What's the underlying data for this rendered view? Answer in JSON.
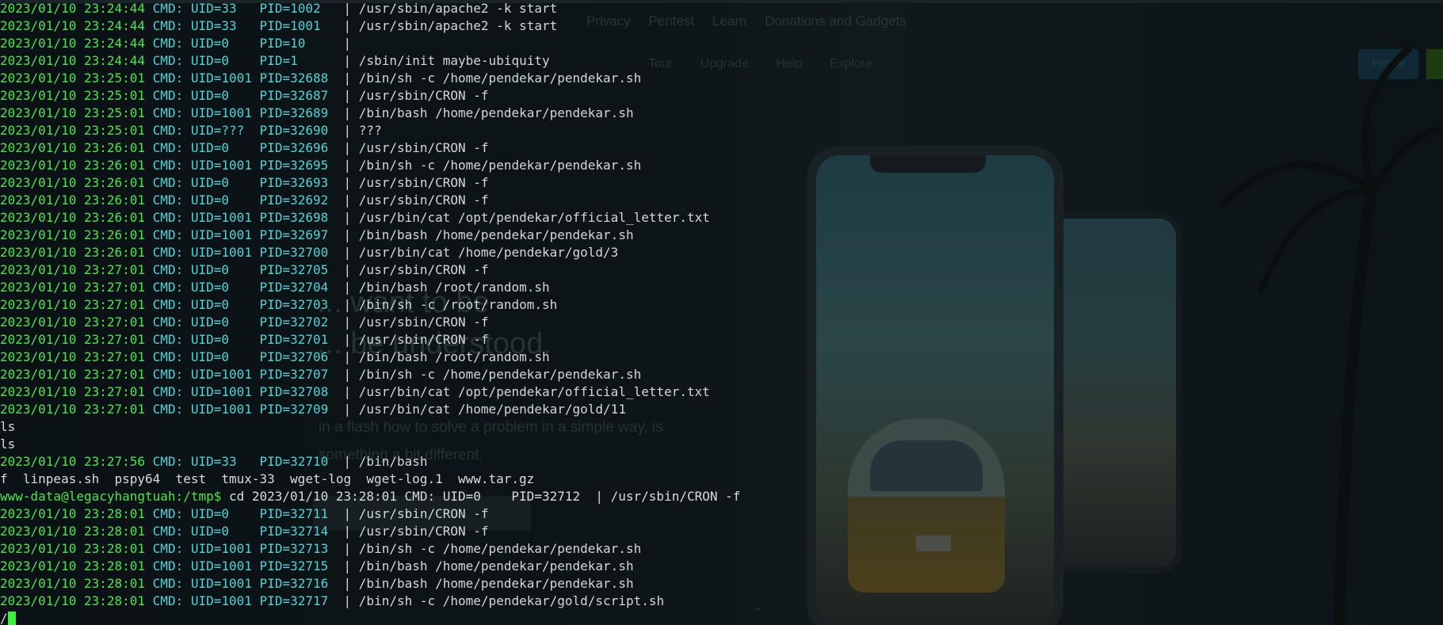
{
  "background_site": {
    "nav_primary": [
      "Privacy",
      "Pentest",
      "Learn",
      "Donations and Gadgets"
    ],
    "nav_secondary": [
      "Tour",
      "Upgrade",
      "Help",
      "Explore"
    ],
    "profile_button": "Profile",
    "headline_lines": [
      "... want to be",
      "... be understood."
    ],
    "paragraph_lines": [
      "in a flash how to solve a problem in a simple way, is",
      "something a bit different."
    ]
  },
  "terminal": {
    "cursor_prefix": "/",
    "lines": [
      {
        "kind": "pspy",
        "ts": "2023/01/10 23:24:44",
        "cmd": "CMD:",
        "uid": "UID=33  ",
        "pid": "PID=1002 ",
        "sep": "|",
        "command": "/usr/sbin/apache2 -k start"
      },
      {
        "kind": "pspy",
        "ts": "2023/01/10 23:24:44",
        "cmd": "CMD:",
        "uid": "UID=33  ",
        "pid": "PID=1001 ",
        "sep": "|",
        "command": "/usr/sbin/apache2 -k start"
      },
      {
        "kind": "pspy",
        "ts": "2023/01/10 23:24:44",
        "cmd": "CMD:",
        "uid": "UID=0   ",
        "pid": "PID=10   ",
        "sep": "|",
        "command": ""
      },
      {
        "kind": "pspy",
        "ts": "2023/01/10 23:24:44",
        "cmd": "CMD:",
        "uid": "UID=0   ",
        "pid": "PID=1    ",
        "sep": "|",
        "command": "/sbin/init maybe-ubiquity"
      },
      {
        "kind": "pspy",
        "ts": "2023/01/10 23:25:01",
        "cmd": "CMD:",
        "uid": "UID=1001",
        "pid": "PID=32688",
        "sep": "|",
        "command": "/bin/sh -c /home/pendekar/pendekar.sh"
      },
      {
        "kind": "pspy",
        "ts": "2023/01/10 23:25:01",
        "cmd": "CMD:",
        "uid": "UID=0   ",
        "pid": "PID=32687",
        "sep": "|",
        "command": "/usr/sbin/CRON -f"
      },
      {
        "kind": "pspy",
        "ts": "2023/01/10 23:25:01",
        "cmd": "CMD:",
        "uid": "UID=1001",
        "pid": "PID=32689",
        "sep": "|",
        "command": "/bin/bash /home/pendekar/pendekar.sh"
      },
      {
        "kind": "pspy",
        "ts": "2023/01/10 23:25:01",
        "cmd": "CMD:",
        "uid": "UID=???",
        "pid": " PID=32690",
        "sep": "|",
        "command": "???"
      },
      {
        "kind": "pspy",
        "ts": "2023/01/10 23:26:01",
        "cmd": "CMD:",
        "uid": "UID=0   ",
        "pid": "PID=32696",
        "sep": "|",
        "command": "/usr/sbin/CRON -f"
      },
      {
        "kind": "pspy",
        "ts": "2023/01/10 23:26:01",
        "cmd": "CMD:",
        "uid": "UID=1001",
        "pid": "PID=32695",
        "sep": "|",
        "command": "/bin/sh -c /home/pendekar/pendekar.sh"
      },
      {
        "kind": "pspy",
        "ts": "2023/01/10 23:26:01",
        "cmd": "CMD:",
        "uid": "UID=0   ",
        "pid": "PID=32693",
        "sep": "|",
        "command": "/usr/sbin/CRON -f"
      },
      {
        "kind": "pspy",
        "ts": "2023/01/10 23:26:01",
        "cmd": "CMD:",
        "uid": "UID=0   ",
        "pid": "PID=32692",
        "sep": "|",
        "command": "/usr/sbin/CRON -f"
      },
      {
        "kind": "pspy",
        "ts": "2023/01/10 23:26:01",
        "cmd": "CMD:",
        "uid": "UID=1001",
        "pid": "PID=32698",
        "sep": "|",
        "command": "/usr/bin/cat /opt/pendekar/official_letter.txt"
      },
      {
        "kind": "pspy",
        "ts": "2023/01/10 23:26:01",
        "cmd": "CMD:",
        "uid": "UID=1001",
        "pid": "PID=32697",
        "sep": "|",
        "command": "/bin/bash /home/pendekar/pendekar.sh"
      },
      {
        "kind": "pspy",
        "ts": "2023/01/10 23:26:01",
        "cmd": "CMD:",
        "uid": "UID=1001",
        "pid": "PID=32700",
        "sep": "|",
        "command": "/usr/bin/cat /home/pendekar/gold/3"
      },
      {
        "kind": "pspy",
        "ts": "2023/01/10 23:27:01",
        "cmd": "CMD:",
        "uid": "UID=0   ",
        "pid": "PID=32705",
        "sep": "|",
        "command": "/usr/sbin/CRON -f"
      },
      {
        "kind": "pspy",
        "ts": "2023/01/10 23:27:01",
        "cmd": "CMD:",
        "uid": "UID=0   ",
        "pid": "PID=32704",
        "sep": "|",
        "command": "/bin/bash /root/random.sh"
      },
      {
        "kind": "pspy",
        "ts": "2023/01/10 23:27:01",
        "cmd": "CMD:",
        "uid": "UID=0   ",
        "pid": "PID=32703",
        "sep": "|",
        "command": "/bin/sh -c /root/random.sh"
      },
      {
        "kind": "pspy",
        "ts": "2023/01/10 23:27:01",
        "cmd": "CMD:",
        "uid": "UID=0   ",
        "pid": "PID=32702",
        "sep": "|",
        "command": "/usr/sbin/CRON -f"
      },
      {
        "kind": "pspy",
        "ts": "2023/01/10 23:27:01",
        "cmd": "CMD:",
        "uid": "UID=0   ",
        "pid": "PID=32701",
        "sep": "|",
        "command": "/usr/sbin/CRON -f"
      },
      {
        "kind": "pspy",
        "ts": "2023/01/10 23:27:01",
        "cmd": "CMD:",
        "uid": "UID=0   ",
        "pid": "PID=32706",
        "sep": "|",
        "command": "/bin/bash /root/random.sh"
      },
      {
        "kind": "pspy",
        "ts": "2023/01/10 23:27:01",
        "cmd": "CMD:",
        "uid": "UID=1001",
        "pid": "PID=32707",
        "sep": "|",
        "command": "/bin/sh -c /home/pendekar/pendekar.sh"
      },
      {
        "kind": "pspy",
        "ts": "2023/01/10 23:27:01",
        "cmd": "CMD:",
        "uid": "UID=1001",
        "pid": "PID=32708",
        "sep": "|",
        "command": "/usr/bin/cat /opt/pendekar/official_letter.txt"
      },
      {
        "kind": "pspy",
        "ts": "2023/01/10 23:27:01",
        "cmd": "CMD:",
        "uid": "UID=1001",
        "pid": "PID=32709",
        "sep": "|",
        "command": "/usr/bin/cat /home/pendekar/gold/11"
      },
      {
        "kind": "plain",
        "text": "ls"
      },
      {
        "kind": "plain",
        "text": "ls"
      },
      {
        "kind": "pspy",
        "ts": "2023/01/10 23:27:56",
        "cmd": "CMD:",
        "uid": "UID=33  ",
        "pid": "PID=32710",
        "sep": "|",
        "command": "/bin/bash"
      },
      {
        "kind": "plain",
        "text": "f  linpeas.sh  pspy64  test  tmux-33  wget-log  wget-log.1  www.tar.gz"
      },
      {
        "kind": "prompt",
        "prompt": "www-data@legacyhangtuah:/tmp$",
        "text": " cd 2023/01/10 23:28:01 CMD: UID=0    PID=32712  | /usr/sbin/CRON -f"
      },
      {
        "kind": "pspy",
        "ts": "2023/01/10 23:28:01",
        "cmd": "CMD:",
        "uid": "UID=0   ",
        "pid": "PID=32711",
        "sep": "|",
        "command": "/usr/sbin/CRON -f"
      },
      {
        "kind": "pspy",
        "ts": "2023/01/10 23:28:01",
        "cmd": "CMD:",
        "uid": "UID=0   ",
        "pid": "PID=32714",
        "sep": "|",
        "command": "/usr/sbin/CRON -f"
      },
      {
        "kind": "pspy",
        "ts": "2023/01/10 23:28:01",
        "cmd": "CMD:",
        "uid": "UID=1001",
        "pid": "PID=32713",
        "sep": "|",
        "command": "/bin/sh -c /home/pendekar/pendekar.sh"
      },
      {
        "kind": "pspy",
        "ts": "2023/01/10 23:28:01",
        "cmd": "CMD:",
        "uid": "UID=1001",
        "pid": "PID=32715",
        "sep": "|",
        "command": "/bin/bash /home/pendekar/pendekar.sh"
      },
      {
        "kind": "pspy",
        "ts": "2023/01/10 23:28:01",
        "cmd": "CMD:",
        "uid": "UID=1001",
        "pid": "PID=32716",
        "sep": "|",
        "command": "/bin/bash /home/pendekar/pendekar.sh"
      },
      {
        "kind": "pspy",
        "ts": "2023/01/10 23:28:01",
        "cmd": "CMD:",
        "uid": "UID=1001",
        "pid": "PID=32717",
        "sep": "|",
        "command": "/bin/sh -c /home/pendekar/gold/script.sh"
      }
    ]
  }
}
